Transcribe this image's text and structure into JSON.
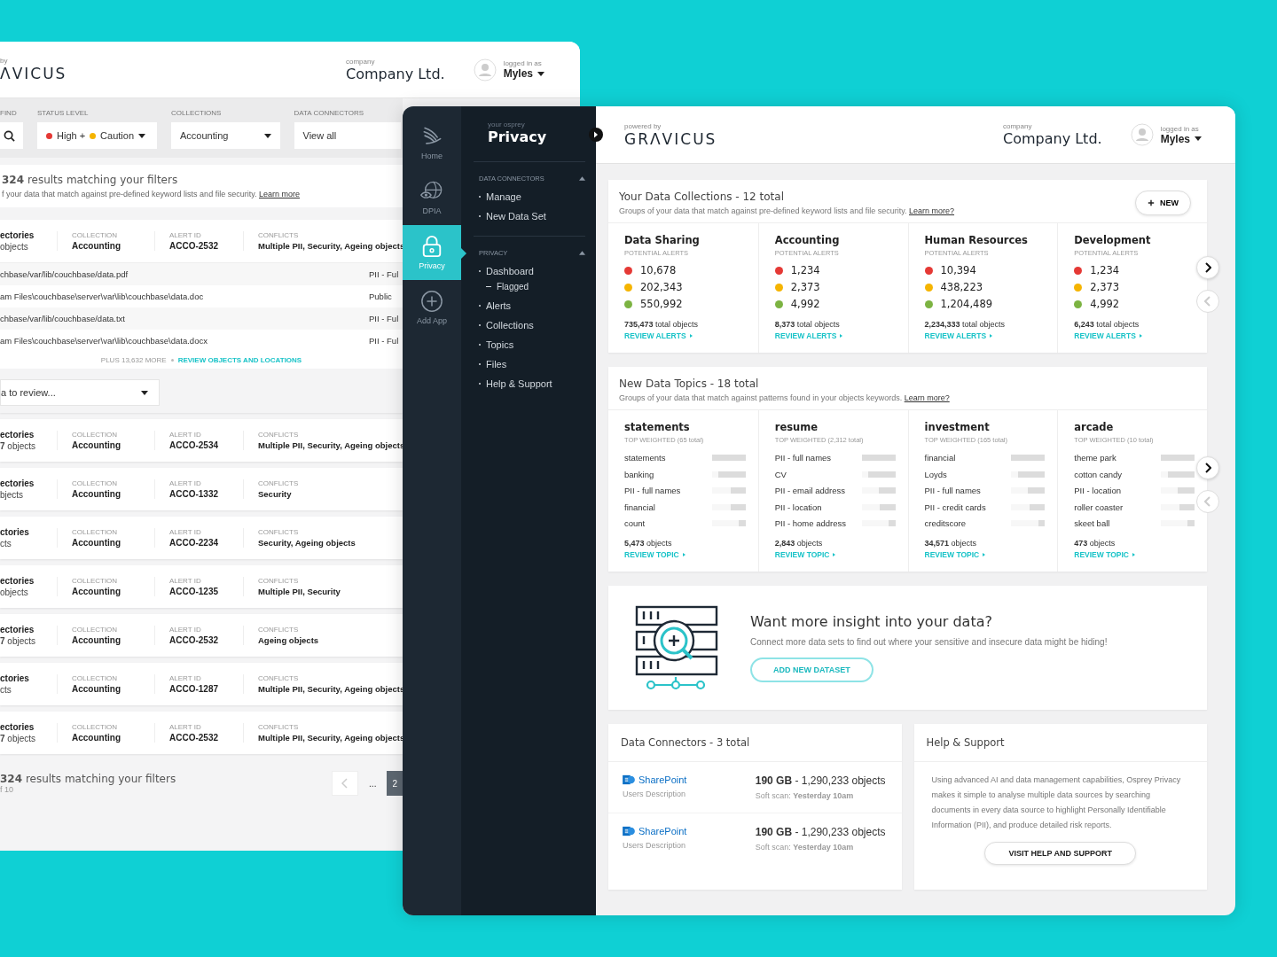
{
  "back_window": {
    "powered_by": "by",
    "logo": "ΛVICUS",
    "company_caption": "company",
    "company": "Company Ltd.",
    "user_caption": "logged in as",
    "user": "Myles",
    "filters": [
      {
        "kind": "search",
        "label": "FIND"
      },
      {
        "kind": "status",
        "label": "STATUS LEVEL",
        "levels": [
          {
            "text": "High +",
            "color": "#e53935"
          },
          {
            "text": "Caution",
            "color": "#f5b400"
          }
        ]
      },
      {
        "kind": "select",
        "label": "COLLECTIONS",
        "value": "Accounting"
      },
      {
        "kind": "select",
        "label": "DATA CONNECTORS",
        "value": "View all"
      }
    ],
    "results_title": "**324** results matching your filters",
    "results_subtitle": "f your data that match against pre-defined keyword lists and file security.",
    "learn_more": "Learn more",
    "alerts": [
      {
        "expanded": true,
        "directories": "ectories",
        "objects": "objects",
        "collection_label": "COLLECTION",
        "collection": "Accounting",
        "alert_label": "ALERT ID",
        "alert_id": "ACCO-2532",
        "conflicts_label": "CONFLICTS",
        "conflicts": "Multiple PII, Security, Ageing objects",
        "files": [
          {
            "path": "chbase/var/lib/couchbase/data.pdf",
            "tag": "PII - Ful"
          },
          {
            "path": "am Files\\couchbase\\server\\var\\lib\\couchbase\\data.doc",
            "tag": "Public"
          },
          {
            "path": "chbase/var/lib/couchbase/data.txt",
            "tag": "PII - Ful"
          },
          {
            "path": "am Files\\couchbase\\server\\var\\lib\\couchbase\\data.docx",
            "tag": "PII - Ful"
          }
        ],
        "more": "PLUS 13,632 MORE",
        "more_link": "REVIEW OBJECTS AND LOCATIONS",
        "review_select": "a to review..."
      },
      {
        "expanded": false,
        "directories": "ectories",
        "objects": "**7** objects",
        "collection_label": "COLLECTION",
        "collection": "Accounting",
        "alert_label": "ALERT ID",
        "alert_id": "ACCO-2534",
        "conflicts_label": "CONFLICTS",
        "conflicts": "Multiple PII, Security, Ageing objects"
      },
      {
        "expanded": false,
        "directories": "ectories",
        "objects": "bjects",
        "collection_label": "COLLECTION",
        "collection": "Accounting",
        "alert_label": "ALERT ID",
        "alert_id": "ACCO-1332",
        "conflicts_label": "CONFLICTS",
        "conflicts": "Security"
      },
      {
        "expanded": false,
        "directories": "ctories",
        "objects": "cts",
        "collection_label": "COLLECTION",
        "collection": "Accounting",
        "alert_label": "ALERT ID",
        "alert_id": "ACCO-2234",
        "conflicts_label": "CONFLICTS",
        "conflicts": "Security, Ageing objects"
      },
      {
        "expanded": false,
        "directories": "ectories",
        "objects": "objects",
        "collection_label": "COLLECTION",
        "collection": "Accounting",
        "alert_label": "ALERT ID",
        "alert_id": "ACCO-1235",
        "conflicts_label": "CONFLICTS",
        "conflicts": "Multiple PII, Security"
      },
      {
        "expanded": false,
        "directories": "ectories",
        "objects": "**7** objects",
        "collection_label": "COLLECTION",
        "collection": "Accounting",
        "alert_label": "ALERT ID",
        "alert_id": "ACCO-2532",
        "conflicts_label": "CONFLICTS",
        "conflicts": "Ageing objects"
      },
      {
        "expanded": false,
        "directories": "ctories",
        "objects": "cts",
        "collection_label": "COLLECTION",
        "collection": "Accounting",
        "alert_label": "ALERT ID",
        "alert_id": "ACCO-1287",
        "conflicts_label": "CONFLICTS",
        "conflicts": "Multiple PII, Security, Ageing objects"
      },
      {
        "expanded": false,
        "directories": "ectories",
        "objects": "**7** objects",
        "collection_label": "COLLECTION",
        "collection": "Accounting",
        "alert_label": "ALERT ID",
        "alert_id": "ACCO-2532",
        "conflicts_label": "CONFLICTS",
        "conflicts": "Multiple PII, Security, Ageing objects"
      }
    ],
    "footer_title": "**324** results matching your filters",
    "footer_pages": "f 10",
    "pages": [
      {
        "label": "...",
        "selected": false
      },
      {
        "label": "2",
        "selected": true
      }
    ]
  },
  "front_window": {
    "rail": [
      {
        "label": "Home",
        "selected": false
      },
      {
        "label": "DPIA",
        "selected": false
      },
      {
        "label": "Privacy",
        "selected": true
      },
      {
        "label": "Add App",
        "selected": false
      }
    ],
    "panel": {
      "caption": "your osprey",
      "title": "Privacy",
      "sections": [
        {
          "title": "DATA CONNECTORS",
          "expanded": true,
          "items": [
            {
              "label": "Manage"
            },
            {
              "label": "New Data Set"
            }
          ]
        },
        {
          "title": "PRIVACY",
          "expanded": true,
          "items": [
            {
              "label": "Dashboard",
              "children": [
                {
                  "label": "Flagged"
                }
              ]
            },
            {
              "label": "Alerts"
            },
            {
              "label": "Collections"
            },
            {
              "label": "Topics"
            },
            {
              "label": "Files"
            },
            {
              "label": "Help & Support"
            }
          ]
        }
      ]
    },
    "header": {
      "powered_by": "powered by",
      "logo": "GRΛVICUS",
      "company_caption": "company",
      "company": "Company Ltd.",
      "user_caption": "logged in as",
      "user": "Myles"
    },
    "collections": {
      "title": "Your Data Collections - 12 total",
      "subtitle": "Groups of your data that match against pre-defined keyword lists and file security.",
      "learn_more": "Learn more?",
      "new_button": "NEW",
      "nav": [
        {
          "kind": "next",
          "disabled": false
        },
        {
          "kind": "prev",
          "disabled": true
        }
      ],
      "items": [
        {
          "name": "Data Sharing",
          "alerts_label": "POTENTIAL ALERTS",
          "alerts": [
            {
              "value": "10,678",
              "color": "#e53935"
            },
            {
              "value": "202,343",
              "color": "#f5b400"
            },
            {
              "value": "550,992",
              "color": "#7cb342"
            }
          ],
          "total": "**735,473** total objects",
          "link": "REVIEW ALERTS"
        },
        {
          "name": "Accounting",
          "alerts_label": "POTENTIAL ALERTS",
          "alerts": [
            {
              "value": "1,234",
              "color": "#e53935"
            },
            {
              "value": "2,373",
              "color": "#f5b400"
            },
            {
              "value": "4,992",
              "color": "#7cb342"
            }
          ],
          "total": "**8,373** total objects",
          "link": "REVIEW ALERTS"
        },
        {
          "name": "Human Resources",
          "alerts_label": "POTENTIAL ALERTS",
          "alerts": [
            {
              "value": "10,394",
              "color": "#e53935"
            },
            {
              "value": "438,223",
              "color": "#f5b400"
            },
            {
              "value": "1,204,489",
              "color": "#7cb342"
            }
          ],
          "total": "**2,234,333** total objects",
          "link": "REVIEW ALERTS"
        },
        {
          "name": "Development",
          "alerts_label": "POTENTIAL ALERTS",
          "alerts": [
            {
              "value": "1,234",
              "color": "#e53935"
            },
            {
              "value": "2,373",
              "color": "#f5b400"
            },
            {
              "value": "4,992",
              "color": "#7cb342"
            }
          ],
          "total": "**6,243** total objects",
          "link": "REVIEW ALERTS"
        }
      ]
    },
    "topics": {
      "title": "New Data Topics - 18 total",
      "subtitle": "Groups of your data that match against patterns found in your objects keywords.",
      "learn_more": "Learn more?",
      "nav": [
        {
          "kind": "next",
          "disabled": false
        },
        {
          "kind": "prev",
          "disabled": true
        }
      ],
      "items": [
        {
          "name": "statements",
          "weighted": "TOP WEIGHTED (65 total)",
          "keywords": [
            {
              "text": "statements",
              "level": 1
            },
            {
              "text": "banking",
              "level": 0.8
            },
            {
              "text": "PII - full names",
              "level": 0.45
            },
            {
              "text": "financial",
              "level": 0.45
            },
            {
              "text": "count",
              "level": 0.2
            }
          ],
          "count": "**5,473** objects",
          "link": "REVIEW TOPIC"
        },
        {
          "name": "resume",
          "weighted": "TOP WEIGHTED (2,312 total)",
          "keywords": [
            {
              "text": "PII - full names",
              "level": 1
            },
            {
              "text": "CV",
              "level": 0.8
            },
            {
              "text": "PII - email address",
              "level": 0.5
            },
            {
              "text": "PII - location",
              "level": 0.45
            },
            {
              "text": "PII - home address",
              "level": 0.2
            }
          ],
          "count": "**2,843** objects",
          "link": "REVIEW TOPIC"
        },
        {
          "name": "investment",
          "weighted": "TOP WEIGHTED (165 total)",
          "keywords": [
            {
              "text": "financial",
              "level": 1
            },
            {
              "text": "Loyds",
              "level": 0.8
            },
            {
              "text": "PII - full names",
              "level": 0.5
            },
            {
              "text": "PII - credit cards",
              "level": 0.45
            },
            {
              "text": "creditscore",
              "level": 0.2
            }
          ],
          "count": "**34,571** objects",
          "link": "REVIEW TOPIC"
        },
        {
          "name": "arcade",
          "weighted": "TOP WEIGHTED (10 total)",
          "keywords": [
            {
              "text": "theme park",
              "level": 1
            },
            {
              "text": "cotton candy",
              "level": 0.8
            },
            {
              "text": "PII - location",
              "level": 0.5
            },
            {
              "text": "roller coaster",
              "level": 0.45
            },
            {
              "text": "skeet ball",
              "level": 0.2
            }
          ],
          "count": "**473** objects",
          "link": "REVIEW TOPIC"
        }
      ]
    },
    "insight": {
      "title": "Want more insight into your data?",
      "text": "Connect more data sets to find out where your sensitive and insecure data might be hiding!",
      "button": "ADD NEW DATASET"
    },
    "connectors": {
      "title": "Data Connectors - 3 total",
      "items": [
        {
          "name": "SharePoint",
          "description": "Users Description",
          "size": "**190 GB** - 1,290,233 objects",
          "scan": "Soft scan: **Yesterday 10am**"
        },
        {
          "name": "SharePoint",
          "description": "Users Description",
          "size": "**190 GB** - 1,290,233 objects",
          "scan": "Soft scan: **Yesterday 10am**"
        }
      ]
    },
    "help": {
      "title": "Help & Support",
      "text": "Using advanced AI and data management capabilities, Osprey Privacy makes it simple to analyse multiple data sources by searching documents in every data source to highlight Personally Identifiable Information (PII), and produce detailed risk reports.",
      "button": "VISIT HELP AND SUPPORT"
    }
  }
}
